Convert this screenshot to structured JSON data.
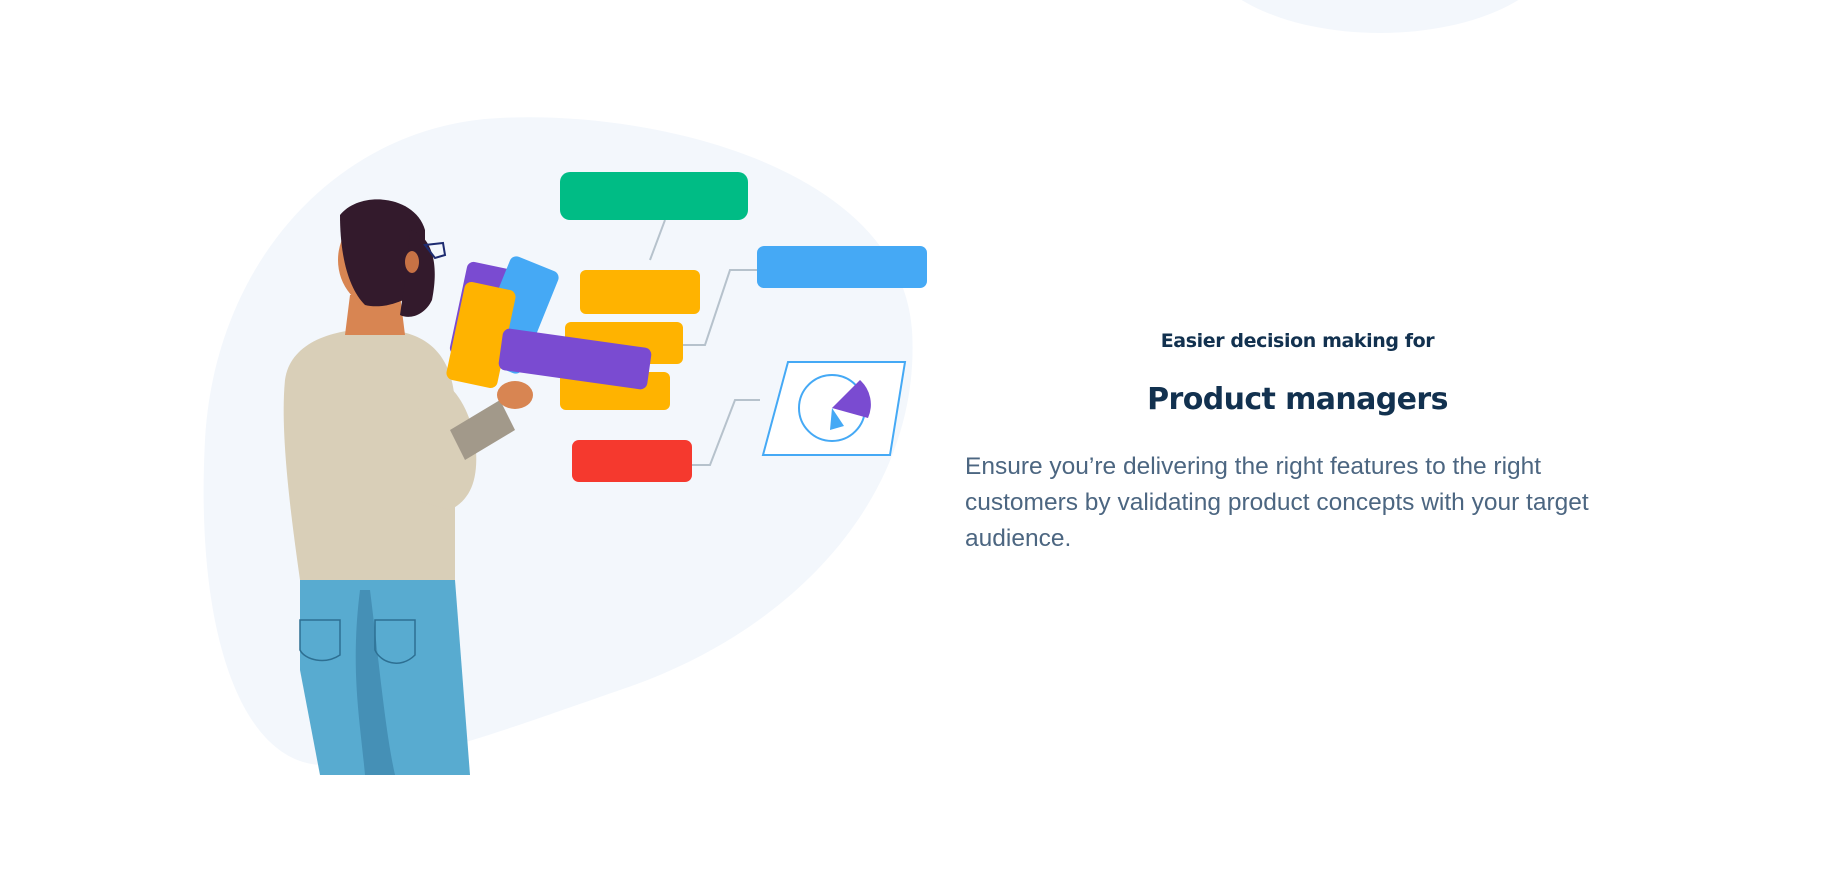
{
  "section": {
    "eyebrow": "Easier decision making for",
    "title": "Product managers",
    "description": "Ensure you’re delivering the right features to the right customers by validating product concepts with your target audience."
  },
  "illustration": {
    "subject": "person-organizing-product-cards",
    "colors": {
      "background_blob": "#f3f7fc",
      "green_card": "#00bc85",
      "blue_card": "#45a9f5",
      "yellow_card": "#ffb300",
      "purple_card": "#7a4bd1",
      "red_card": "#f5392e",
      "sweater": "#d9cfb8",
      "jeans": "#58abd0",
      "hair": "#331a2c",
      "skin": "#d88552"
    }
  },
  "colors": {
    "heading": "#12314f",
    "body_text": "#4c6681",
    "page_background": "#ffffff"
  }
}
